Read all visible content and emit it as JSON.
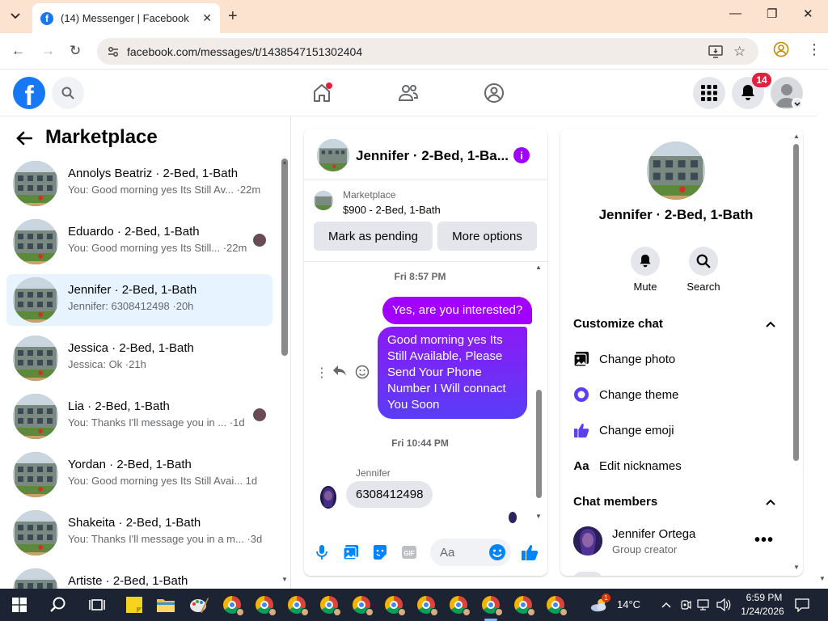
{
  "browser": {
    "tab_title": "(14) Messenger | Facebook",
    "url": "facebook.com/messages/t/1438547151302404",
    "favicon_letter": "f"
  },
  "fbnav": {
    "logo_letter": "f",
    "notifications_count": "14"
  },
  "left": {
    "title": "Marketplace",
    "conversations": [
      {
        "name": "Annolys Beatriz · 2-Bed, 1-Bath",
        "preview": "You: Good morning yes Its Still Av... ·22m",
        "active": false,
        "mini_avatar": false
      },
      {
        "name": "Eduardo · 2-Bed, 1-Bath",
        "preview": "You: Good morning yes Its Still... ·22m",
        "active": false,
        "mini_avatar": true
      },
      {
        "name": "Jennifer · 2-Bed, 1-Bath",
        "preview": "Jennifer: 6308412498 ·20h",
        "active": true,
        "mini_avatar": false
      },
      {
        "name": "Jessica · 2-Bed, 1-Bath",
        "preview": "Jessica: Ok ·21h",
        "active": false,
        "mini_avatar": false
      },
      {
        "name": "Lia · 2-Bed, 1-Bath",
        "preview": "You: Thanks I'll message you in ... ·1d",
        "active": false,
        "mini_avatar": true
      },
      {
        "name": "Yordan · 2-Bed, 1-Bath",
        "preview": "You: Good morning yes Its Still Avai... 1d",
        "active": false,
        "mini_avatar": false
      },
      {
        "name": "Shakeita · 2-Bed, 1-Bath",
        "preview": "You: Thanks I'll message you in a m... ·3d",
        "active": false,
        "mini_avatar": false
      },
      {
        "name": "Artiste · 2-Bed, 1-Bath",
        "preview": "",
        "active": false,
        "mini_avatar": false
      }
    ]
  },
  "chat": {
    "title": "Jennifer · 2-Bed, 1-Ba...",
    "marketplace_label": "Marketplace",
    "listing": "$900 - 2-Bed, 1-Bath",
    "mark_pending": "Mark as pending",
    "more_options": "More options",
    "time1": "Fri 8:57 PM",
    "msg_out_1": "Yes, are you interested?",
    "msg_out_2": "Good morning yes Its Still Available, Please Send Your Phone Number I Will connact You Soon",
    "time2": "Fri 10:44 PM",
    "sender": "Jennifer",
    "msg_in_1": "6308412498",
    "composer_placeholder": "Aa"
  },
  "right": {
    "name": "Jennifer · 2-Bed, 1-Bath",
    "mute": "Mute",
    "search": "Search",
    "customize": "Customize chat",
    "change_photo": "Change photo",
    "change_theme": "Change theme",
    "change_emoji": "Change emoji",
    "edit_nicknames": "Edit nicknames",
    "members": "Chat members",
    "member_name": "Jennifer Ortega",
    "member_role": "Group creator",
    "aa_glyph": "Aa"
  },
  "taskbar": {
    "weather": "14°C",
    "time": "6:59 PM",
    "date": "1/24/2026",
    "weather_badge": "1"
  },
  "colors": {
    "fb_blue": "#1877f2",
    "messenger_purple": "#a100ff",
    "badge_red": "#e41e3f",
    "active_row": "#e7f3ff"
  }
}
